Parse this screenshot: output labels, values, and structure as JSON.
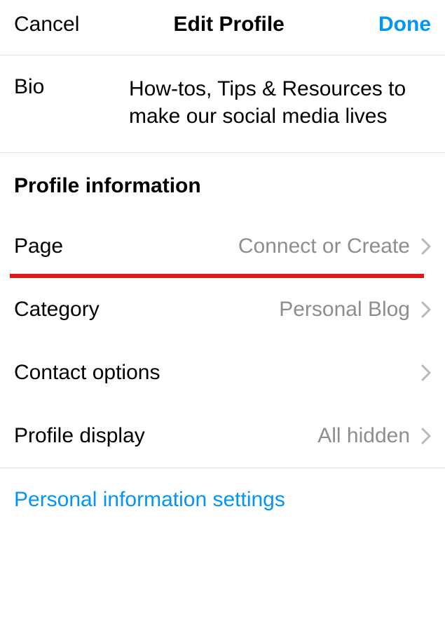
{
  "header": {
    "cancel": "Cancel",
    "title": "Edit Profile",
    "done": "Done"
  },
  "bio": {
    "label": "Bio",
    "value": "How-tos, Tips & Resources to make our social media lives"
  },
  "section": {
    "title": "Profile information"
  },
  "rows": {
    "page": {
      "label": "Page",
      "value": "Connect or Create"
    },
    "category": {
      "label": "Category",
      "value": "Personal Blog"
    },
    "contact": {
      "label": "Contact options",
      "value": ""
    },
    "display": {
      "label": "Profile display",
      "value": "All hidden"
    }
  },
  "link": {
    "personal_info": "Personal information settings"
  }
}
